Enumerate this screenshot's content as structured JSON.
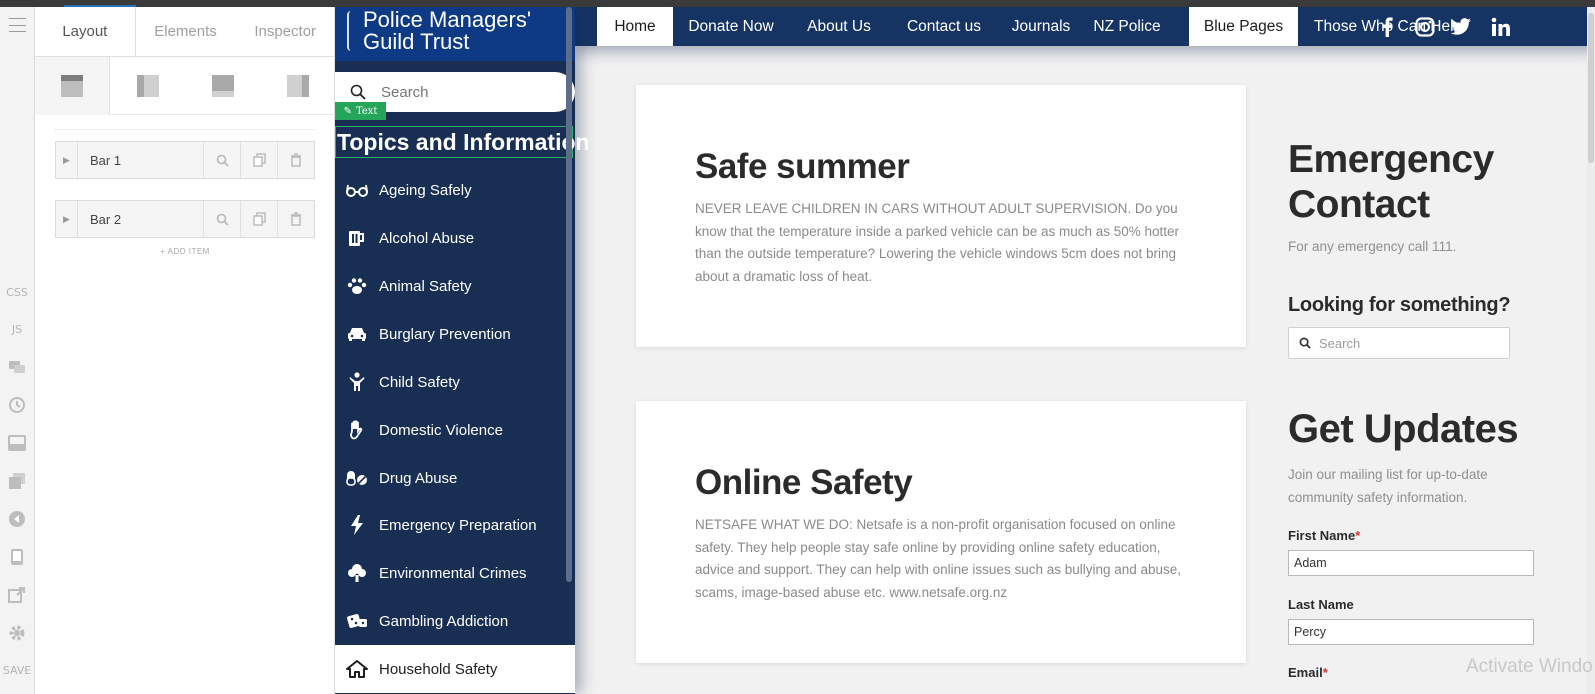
{
  "builder": {
    "tabs": [
      "Layout",
      "Elements",
      "Inspector"
    ],
    "layout_buttons": [
      "layout-top-bar-icon",
      "layout-left-bar-icon",
      "layout-bottom-bar-icon",
      "layout-right-bar-icon"
    ],
    "bars": [
      {
        "label": "Bar 1"
      },
      {
        "label": "Bar 2"
      }
    ],
    "add_item_label": "+ ADD ITEM",
    "rail": {
      "css": "CSS",
      "js": "JS",
      "save": "SAVE"
    }
  },
  "site": {
    "logo_line1": "Police Managers'",
    "logo_line2": "Guild Trust",
    "search_placeholder": "Search",
    "text_tag": "Text",
    "topics_heading": "Topics and Information",
    "nav_items": [
      {
        "label": "Ageing Safely",
        "icon": "glasses-icon"
      },
      {
        "label": "Alcohol Abuse",
        "icon": "beer-mug-icon"
      },
      {
        "label": "Animal Safety",
        "icon": "paw-icon"
      },
      {
        "label": "Burglary Prevention",
        "icon": "car-icon"
      },
      {
        "label": "Child Safety",
        "icon": "child-icon"
      },
      {
        "label": "Domestic Violence",
        "icon": "hand-icon"
      },
      {
        "label": "Drug Abuse",
        "icon": "pills-icon"
      },
      {
        "label": "Emergency Preparation",
        "icon": "bolt-icon"
      },
      {
        "label": "Environmental Crimes",
        "icon": "tree-icon"
      },
      {
        "label": "Gambling Addiction",
        "icon": "dice-icon"
      },
      {
        "label": "Household Safety",
        "icon": "home-icon"
      }
    ],
    "active_nav": "Household Safety",
    "top_nav": [
      "Home",
      "Donate Now",
      "About Us",
      "Contact us",
      "Journals",
      "NZ Police",
      "Blue Pages",
      "Those Who Can Help"
    ],
    "social": [
      "facebook-icon",
      "instagram-icon",
      "twitter-icon",
      "linkedin-icon"
    ],
    "cards": [
      {
        "title": "Safe summer",
        "body": "NEVER LEAVE CHILDREN IN CARS WITHOUT ADULT SUPERVISION. Do you know that the temperature inside a parked vehicle can be as much as 50% hotter than the outside temperature? Lowering the vehicle windows 5cm does not bring about a dramatic loss of heat."
      },
      {
        "title": "Online Safety",
        "body": "NETSAFE WHAT WE DO: Netsafe is a non-profit organisation focused on online safety. They help people stay safe online by providing online safety education, advice and support. They can help with online issues such as bullying and abuse, scams, image-based abuse etc. www.netsafe.org.nz"
      }
    ],
    "emergency": {
      "heading": "Emergency Contact",
      "text": "For any emergency call 111."
    },
    "looking": {
      "heading": "Looking for something?",
      "placeholder": "Search"
    },
    "updates": {
      "heading": "Get Updates",
      "text": "Join our mailing list for up-to-date community safety information.",
      "first_name_label": "First Name",
      "first_name_value": "Adam",
      "last_name_label": "Last Name",
      "last_name_value": "Percy",
      "email_label": "Email",
      "required_mark": "*"
    }
  },
  "os": {
    "watermark": "Activate Windo"
  },
  "colors": {
    "nav_dark": "#182e52",
    "top_nav": "#163463",
    "logo_blue": "#0e3a85",
    "text_tag_green": "#24a55a"
  }
}
